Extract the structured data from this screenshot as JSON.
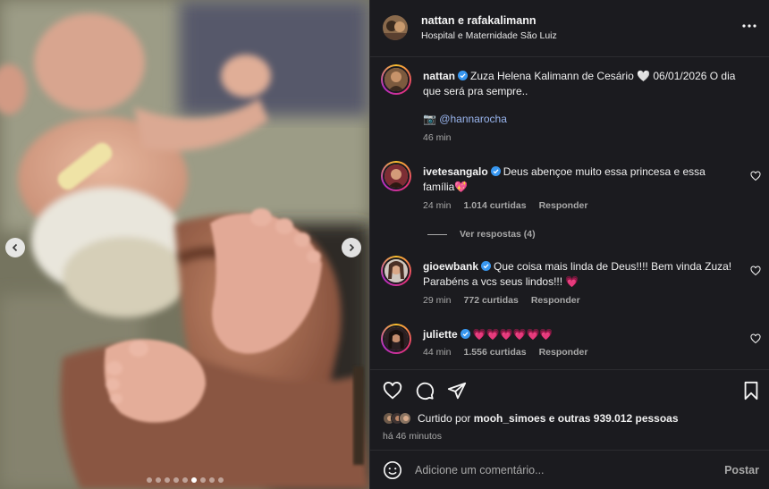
{
  "colors": {
    "background": "#1b1b1f",
    "text": "#f5f5f5",
    "muted": "#a8a8a8",
    "link": "#9ab6ef",
    "verified": "#3897f0",
    "heart": "#ff3040"
  },
  "carousel": {
    "total_slides": 9,
    "active_slide": 6,
    "prev_icon": "chevron-left-icon",
    "next_icon": "chevron-right-icon"
  },
  "header": {
    "title": "nattan e rafakalimann",
    "location": "Hospital e Maternidade São Luiz",
    "more_icon": "more-horizontal-icon"
  },
  "caption": {
    "username": "nattan",
    "text": "Zuza Helena Kalimann de Cesário 🤍 06/01/2026 O dia que será pra sempre..",
    "credit_icon": "📷",
    "credit_mention": "@hannarocha",
    "time": "46 min"
  },
  "comments": [
    {
      "username": "ivetesangalo",
      "text": "Deus abençoe muito essa princesa e essa família💖",
      "time": "24 min",
      "likes": "1.014 curtidas",
      "reply_label": "Responder"
    },
    {
      "username": "gioewbank",
      "text": "Que coisa mais linda de Deus!!!! Bem vinda Zuza! Parabéns a vcs seus lindos!!! 💗",
      "time": "29 min",
      "likes": "772 curtidas",
      "reply_label": "Responder"
    },
    {
      "username": "juliette",
      "text": "💗💗💗💗💗💗",
      "time": "44 min",
      "likes": "1.556 curtidas",
      "reply_label": "Responder"
    }
  ],
  "view_replies": "Ver respostas (4)",
  "actions": {
    "like_icon": "heart-icon",
    "comment_icon": "comment-icon",
    "share_icon": "send-icon",
    "save_icon": "bookmark-icon",
    "liked_prefix": "Curtido por",
    "liked_user": "mooh_simoes",
    "liked_suffix": "e outras 939.012 pessoas",
    "time_ago": "há 46 minutos"
  },
  "add_comment": {
    "placeholder": "Adicione um comentário...",
    "post_label": "Postar",
    "emoji_icon": "emoji-icon"
  }
}
